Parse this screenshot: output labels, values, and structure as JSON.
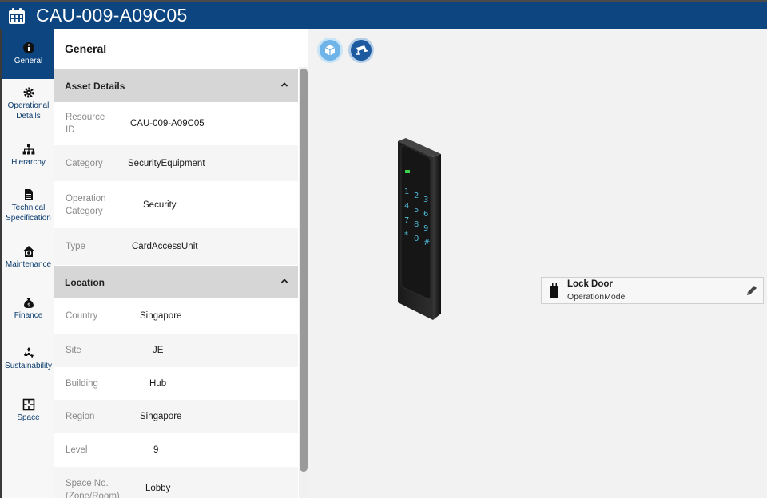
{
  "header": {
    "title": "CAU-009-A09C05",
    "icon": "calendar-icon",
    "color": "#0c4580"
  },
  "nav": [
    {
      "label": "General",
      "icon": "info-icon",
      "active": true
    },
    {
      "label": "Operational Details",
      "icon": "gear-icon",
      "active": false
    },
    {
      "label": "Hierarchy",
      "icon": "hierarchy-icon",
      "active": false
    },
    {
      "label": "Technical Specification",
      "icon": "document-icon",
      "active": false
    },
    {
      "label": "Maintenance",
      "icon": "house-gear-icon",
      "active": false
    },
    {
      "label": "Finance",
      "icon": "money-bag-icon",
      "active": false
    },
    {
      "label": "Sustainability",
      "icon": "recycle-icon",
      "active": false
    },
    {
      "label": "Space",
      "icon": "floorplan-icon",
      "active": false
    }
  ],
  "panel": {
    "title": "General",
    "sections": {
      "asset": {
        "title": "Asset Details",
        "rows": [
          {
            "label": "Resource ID",
            "value": "CAU-009-A09C05"
          },
          {
            "label": "Category",
            "value": "SecurityEquipment"
          },
          {
            "label": "Operation Category",
            "value": "Security"
          },
          {
            "label": "Type",
            "value": "CardAccessUnit"
          }
        ]
      },
      "location": {
        "title": "Location",
        "rows": [
          {
            "label": "Country",
            "value": "Singapore"
          },
          {
            "label": "Site",
            "value": "JE"
          },
          {
            "label": "Building",
            "value": "Hub"
          },
          {
            "label": "Region",
            "value": "Singapore"
          },
          {
            "label": "Level",
            "value": "9"
          },
          {
            "label": "Space No. (Zone/Room)",
            "value": "Lobby"
          }
        ]
      }
    }
  },
  "viewer": {
    "buttons": [
      {
        "icon": "cube-icon"
      },
      {
        "icon": "cctv-camera-icon"
      }
    ],
    "keypad_keys": [
      "1",
      "2",
      "3",
      "4",
      "5",
      "6",
      "7",
      "8",
      "9",
      "*",
      "0",
      "#"
    ],
    "status_card": {
      "name": "Lock Door",
      "mode": "OperationMode",
      "icon": "door-icon",
      "edit_icon": "pencil-icon"
    }
  }
}
